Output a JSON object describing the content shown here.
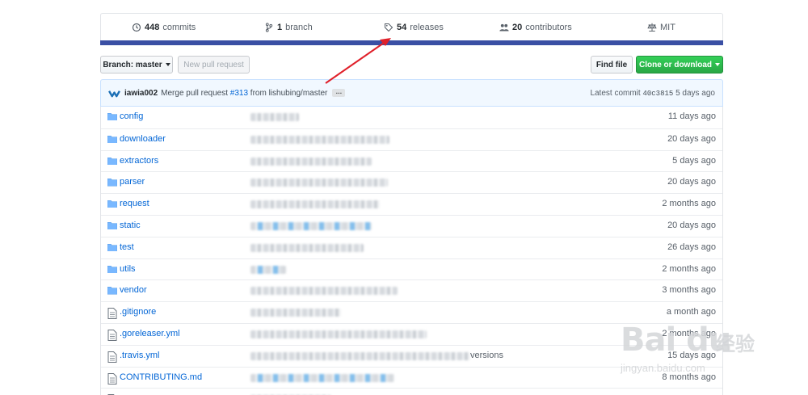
{
  "stats": {
    "commits": {
      "count": "448",
      "label": "commits",
      "icon": "history-icon"
    },
    "branch": {
      "count": "1",
      "label": "branch",
      "icon": "branch-icon"
    },
    "releases": {
      "count": "54",
      "label": "releases",
      "icon": "tag-icon"
    },
    "contributors": {
      "count": "20",
      "label": "contributors",
      "icon": "people-icon"
    },
    "license": {
      "label": "MIT",
      "icon": "law-icon"
    }
  },
  "language_bar_color": "#3a4fa4",
  "toolbar": {
    "branch_label": "Branch: master",
    "new_pull_request_label": "New pull request",
    "find_file_label": "Find file",
    "clone_label": "Clone or download"
  },
  "commit": {
    "author": "iawia002",
    "message_prefix": "Merge pull request",
    "pr_number": "#313",
    "message_suffix": "from lishubing/master",
    "ellipsis": "…",
    "latest_label": "Latest commit",
    "sha": "40c3815",
    "age": "5 days ago"
  },
  "files": [
    {
      "type": "dir",
      "name": "config",
      "age": "11 days ago"
    },
    {
      "type": "dir",
      "name": "downloader",
      "age": "20 days ago"
    },
    {
      "type": "dir",
      "name": "extractors",
      "age": "5 days ago"
    },
    {
      "type": "dir",
      "name": "parser",
      "age": "20 days ago"
    },
    {
      "type": "dir",
      "name": "request",
      "age": "2 months ago"
    },
    {
      "type": "dir",
      "name": "static",
      "age": "20 days ago"
    },
    {
      "type": "dir",
      "name": "test",
      "age": "26 days ago"
    },
    {
      "type": "dir",
      "name": "utils",
      "age": "2 months ago"
    },
    {
      "type": "dir",
      "name": "vendor",
      "age": "3 months ago"
    },
    {
      "type": "file",
      "name": ".gitignore",
      "age": "a month ago"
    },
    {
      "type": "file",
      "name": ".goreleaser.yml",
      "age": "2 months ago"
    },
    {
      "type": "file",
      "name": ".travis.yml",
      "age": "15 days ago",
      "extra": "versions"
    },
    {
      "type": "file",
      "name": "CONTRIBUTING.md",
      "age": "8 months ago"
    },
    {
      "type": "file",
      "name": "",
      "age": ""
    }
  ],
  "watermark": {
    "brand": "Bai du",
    "cn": "经验",
    "url": "jingyan.baidu.com"
  },
  "annotation_color": "#e0202a"
}
